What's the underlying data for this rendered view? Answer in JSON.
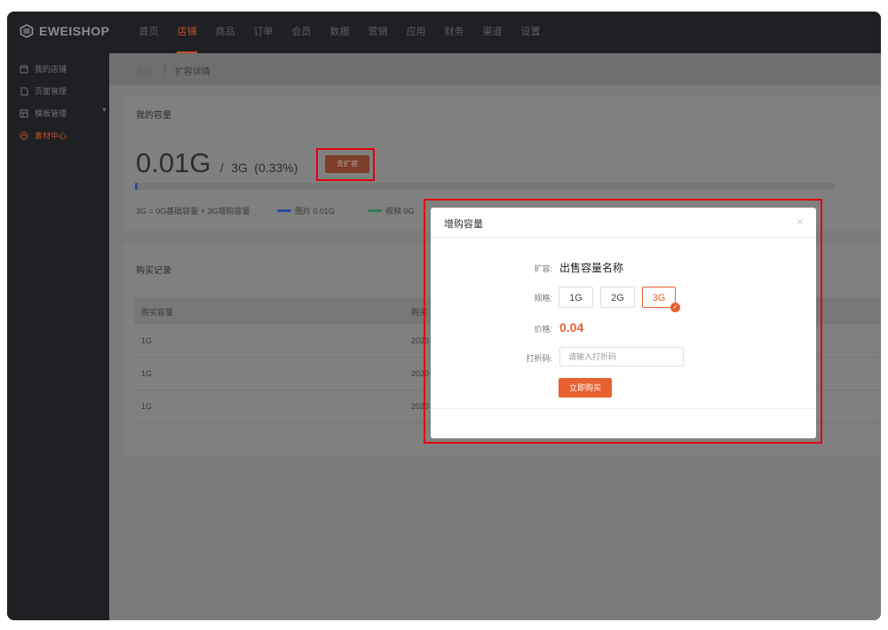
{
  "brand": {
    "name": "EWEISHOP",
    "icon": "eweishop-logo-icon"
  },
  "topnav": {
    "items": [
      "首页",
      "店铺",
      "商品",
      "订单",
      "会员",
      "数据",
      "营销",
      "应用",
      "财务",
      "渠道",
      "设置"
    ],
    "active": "店铺"
  },
  "sidebar": {
    "items": [
      {
        "label": "我的店铺",
        "icon": "store-icon"
      },
      {
        "label": "页面管理",
        "icon": "page-icon"
      },
      {
        "label": "模板管理",
        "icon": "template-icon"
      },
      {
        "label": "素材中心",
        "icon": "material-icon"
      }
    ],
    "active": "素材中心"
  },
  "breadcrumb": {
    "back": "← 返回",
    "title": "扩容详情"
  },
  "capacity": {
    "title": "我的容量",
    "used": "0.01G",
    "slash": "/",
    "total": "3G",
    "percent": "(0.33%)",
    "used_fraction": 0.0033,
    "expand_button": "去扩容",
    "formula": "3G = 0G基础容量 + 3G增购容量",
    "legend": [
      {
        "label": "图片 0.01G",
        "color": "#2f4a9a"
      },
      {
        "label": "视频 0G",
        "color": "#2e7a56"
      }
    ]
  },
  "records": {
    "title": "购买记录",
    "columns": [
      "购买容量",
      "购买"
    ],
    "rows": [
      [
        "1G",
        "2020"
      ],
      [
        "1G",
        "2020"
      ],
      [
        "1G",
        "2020"
      ]
    ]
  },
  "modal": {
    "title": "增购容量",
    "close": "×",
    "expand_label": "扩容:",
    "product_name": "出售容量名称",
    "spec_label": "规格:",
    "specs": [
      "1G",
      "2G",
      "3G"
    ],
    "selected_spec": "3G",
    "price_label": "价格:",
    "price": "0.04",
    "code_label": "打折码:",
    "code_placeholder": "请输入打折码",
    "buy_button": "立即购买"
  },
  "colors": {
    "accent": "#e8602f",
    "highlight": "#e1000f"
  }
}
